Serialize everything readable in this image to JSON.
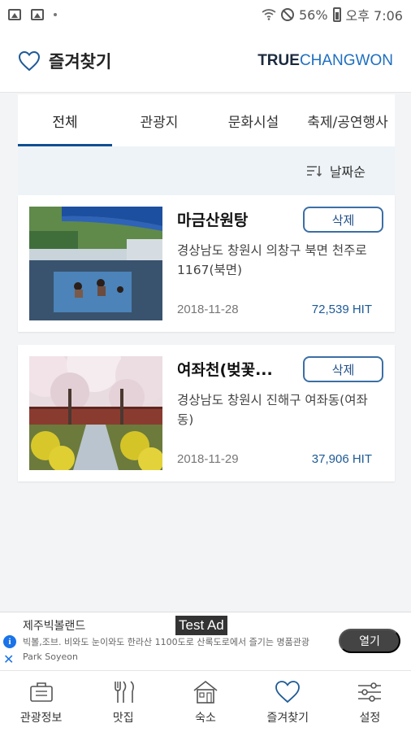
{
  "status_bar": {
    "battery": "56%",
    "time": "오후 7:06"
  },
  "header": {
    "title": "즐겨찾기",
    "brand_bold": "TRUE",
    "brand_light": "CHANGWON"
  },
  "tabs": [
    {
      "label": "전체",
      "active": true
    },
    {
      "label": "관광지",
      "active": false
    },
    {
      "label": "문화시설",
      "active": false
    },
    {
      "label": "축제/공연행사",
      "active": false
    }
  ],
  "sort": {
    "label": "날짜순"
  },
  "favorites": [
    {
      "name": "마금산원탕",
      "delete_label": "삭제",
      "address": "경상남도 창원시 의창구 북면 천주로 1167(북면)",
      "date": "2018-11-28",
      "hits": "72,539 HIT"
    },
    {
      "name": "여좌천(벚꽃...",
      "delete_label": "삭제",
      "address": "경상남도 창원시 진해구 여좌동(여좌동)",
      "date": "2018-11-29",
      "hits": "37,906 HIT"
    }
  ],
  "ad": {
    "badge": "Test Ad",
    "title": "제주빅볼랜드",
    "description": "빅볼,조브. 비와도 눈이와도 한라산 1100도로 산록도로에서 즐기는 명품관광 Park Soyeon",
    "cta": "열기"
  },
  "bottom_nav": [
    {
      "label": "관광정보",
      "icon": "briefcase-icon"
    },
    {
      "label": "맛집",
      "icon": "utensils-icon"
    },
    {
      "label": "숙소",
      "icon": "house-icon"
    },
    {
      "label": "즐겨찾기",
      "icon": "heart-icon"
    },
    {
      "label": "설정",
      "icon": "sliders-icon"
    }
  ]
}
